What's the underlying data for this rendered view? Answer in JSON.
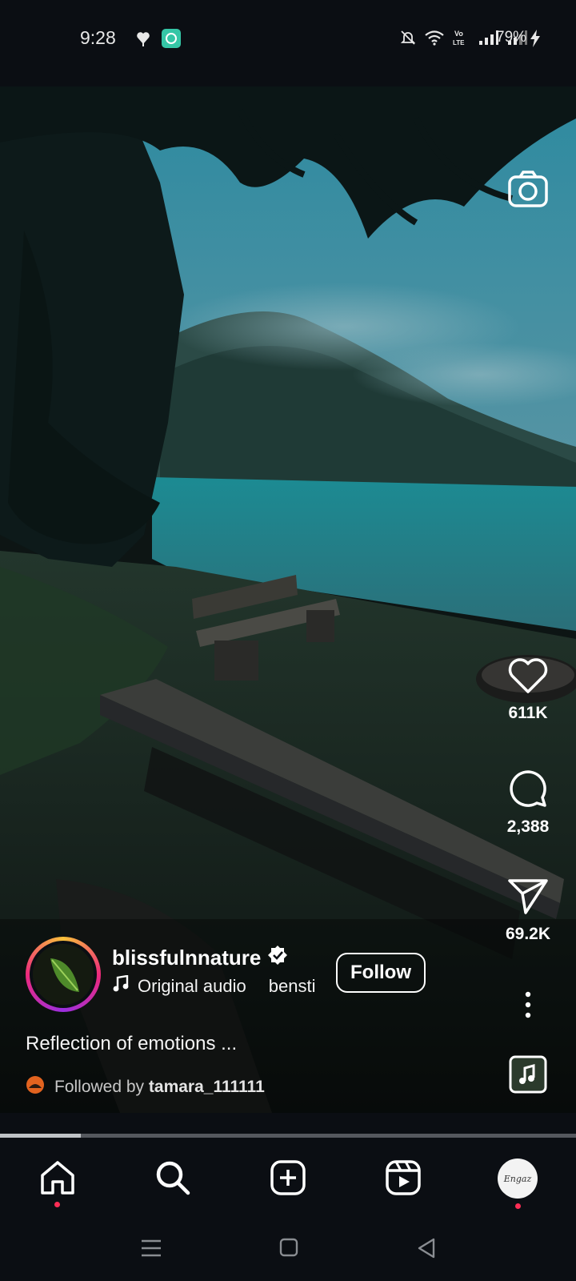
{
  "status_bar": {
    "time": "9:28",
    "battery": "79%",
    "icons": [
      "heart-notification-icon",
      "chat-app-icon",
      "mute-icon",
      "wifi-icon",
      "volte-icon",
      "signal-icon",
      "signal-icon-2",
      "charging-icon"
    ]
  },
  "reel": {
    "likes": "611K",
    "comments": "2,388",
    "shares": "69.2K",
    "username": "blissfulnnature",
    "verified": true,
    "audio_text": "Original audio",
    "audio_secondary": "bensti",
    "follow_label": "Follow",
    "caption": "Reflection of emotions ...",
    "followed_by_prefix": "Followed by",
    "followed_by_user": "tamara_111111",
    "progress": 0.14
  },
  "bottom_nav": {
    "items": [
      "home-icon",
      "search-icon",
      "create-icon",
      "reels-icon",
      "profile-avatar"
    ],
    "profile_avatar_text": "Engaz"
  },
  "colors": {
    "background": "#0b0e13",
    "notification_dot": "#ff2d55",
    "chat_badge": "#35c6a6"
  }
}
